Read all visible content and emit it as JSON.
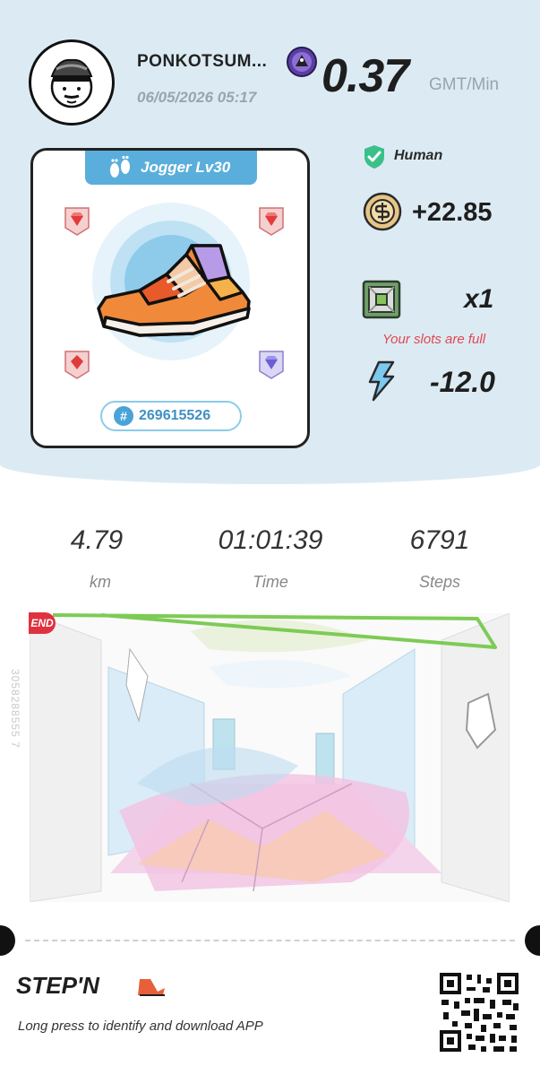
{
  "user": {
    "name": "PONKOTSUM...",
    "timestamp": "06/05/2026 05:17"
  },
  "earnings": {
    "rate": "0.37",
    "unit": "GMT/Min"
  },
  "shoe": {
    "class_label": "Jogger Lv30",
    "id_symbol": "#",
    "id": "269615526",
    "gems": [
      {
        "position": "top-left",
        "color": "red"
      },
      {
        "position": "top-right",
        "color": "red"
      },
      {
        "position": "bottom-left",
        "color": "red"
      },
      {
        "position": "bottom-right",
        "color": "purple"
      }
    ]
  },
  "status": {
    "human_label": "Human",
    "gst": "+22.85",
    "mystery_box_count": "x1",
    "slots_warning": "Your slots are full",
    "energy": "-12.0"
  },
  "stats": [
    {
      "value": "4.79",
      "label": "km"
    },
    {
      "value": "01:01:39",
      "label": "Time"
    },
    {
      "value": "6791",
      "label": "Steps"
    }
  ],
  "route": {
    "end_label": "END",
    "id": "3058288555 7"
  },
  "footer": {
    "logo_text": "STEP'N",
    "hint": "Long press to identify and download APP"
  },
  "colors": {
    "panel": "#dcebf3",
    "accent_blue": "#5aaedb",
    "warning_red": "#e2464f",
    "route_green": "#7dcb55",
    "end_red": "#e0313f"
  }
}
